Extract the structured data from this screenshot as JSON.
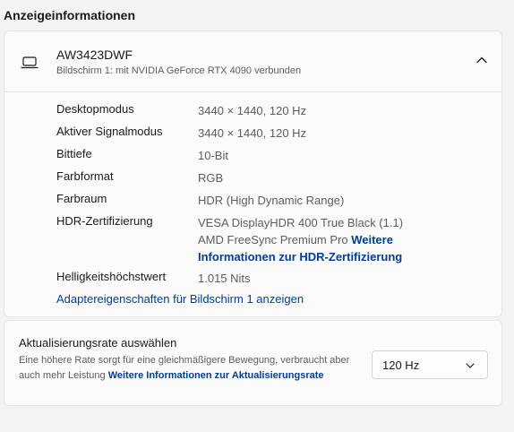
{
  "section": {
    "title": "Anzeigeinformationen"
  },
  "monitor": {
    "name": "AW3423DWF",
    "subtitle": "Bildschirm 1: mit NVIDIA GeForce RTX 4090 verbunden",
    "icon": "laptop-icon",
    "expand_icon": "chevron-up-icon"
  },
  "info": {
    "desktop_mode": {
      "label": "Desktopmodus",
      "value": "3440 × 1440, 120 Hz"
    },
    "active_signal_mode": {
      "label": "Aktiver Signalmodus",
      "value": "3440 × 1440, 120 Hz"
    },
    "bit_depth": {
      "label": "Bittiefe",
      "value": "10-Bit"
    },
    "color_format": {
      "label": "Farbformat",
      "value": "RGB"
    },
    "color_space": {
      "label": "Farbraum",
      "value": "HDR (High Dynamic Range)"
    },
    "hdr_cert": {
      "label": "HDR-Zertifizierung",
      "value_line1": "VESA DisplayHDR 400 True Black (1.1)",
      "value_line2": "AMD FreeSync Premium Pro",
      "link": "Weitere Informationen zur HDR-Zertifizierung"
    },
    "peak_brightness": {
      "label": "Helligkeitshöchstwert",
      "value": "1.015 Nits"
    }
  },
  "adapter_link": "Adaptereigenschaften für Bildschirm 1 anzeigen",
  "refresh": {
    "title": "Aktualisierungsrate auswählen",
    "description": "Eine höhere Rate sorgt für eine gleichmäßigere Bewegung, verbraucht aber auch mehr Leistung",
    "link": "Weitere Informationen zur Aktualisierungsrate",
    "selected": "120 Hz",
    "dropdown_icon": "chevron-down-icon"
  },
  "colors": {
    "background": "#f3f3f3",
    "card": "#fbfbfb",
    "link": "#003e92",
    "secondary_text": "#5d5d5d"
  }
}
